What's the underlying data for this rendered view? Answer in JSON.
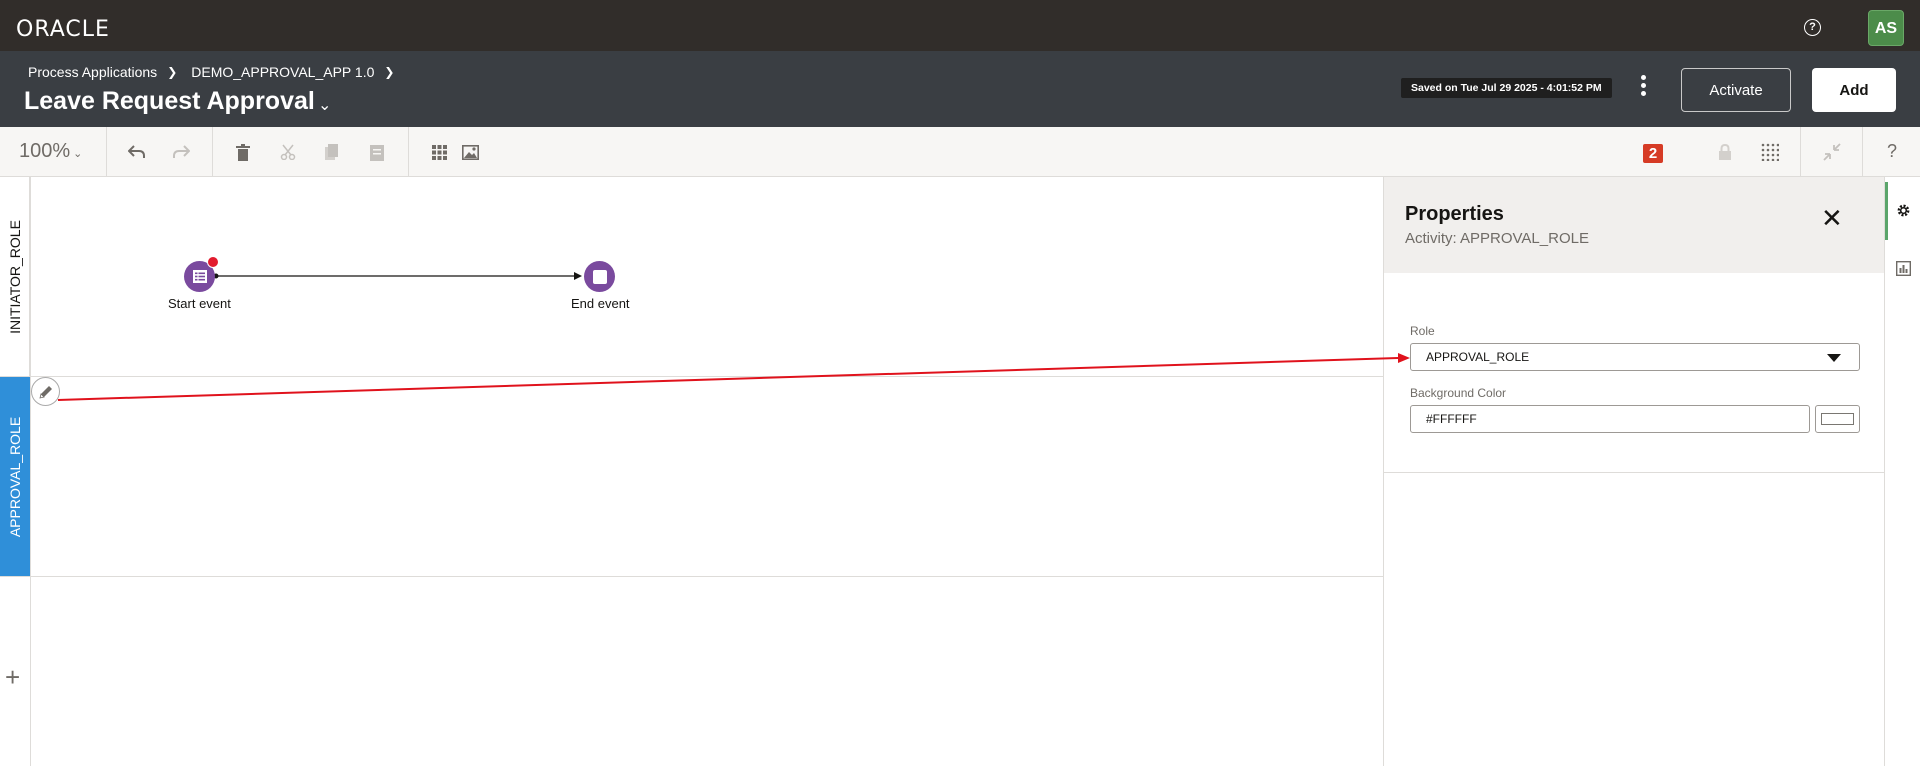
{
  "topbar": {
    "logo": "ORACLE",
    "help_icon": "help-circle-icon",
    "avatar_initials": "AS"
  },
  "header": {
    "breadcrumb": [
      "Process Applications",
      "DEMO_APPROVAL_APP 1.0"
    ],
    "title": "Leave Request Approval",
    "saved_text": "Saved on Tue Jul 29 2025 - 4:01:52 PM",
    "activate_label": "Activate",
    "add_label": "Add"
  },
  "toolbar": {
    "zoom": "100%",
    "error_count": "2",
    "help": "?",
    "icons": [
      "undo-icon",
      "redo-icon",
      "delete-icon",
      "cut-icon",
      "copy-icon",
      "paste-icon",
      "grid-icon",
      "image-icon",
      "lock-icon",
      "dots-grid-icon",
      "collapse-icon"
    ]
  },
  "canvas": {
    "lanes": [
      {
        "name": "INITIATOR_ROLE",
        "selected": false
      },
      {
        "name": "APPROVAL_ROLE",
        "selected": true
      }
    ],
    "events": [
      {
        "label": "Start event",
        "type": "start"
      },
      {
        "label": "End event",
        "type": "end"
      }
    ],
    "add_lane": "+"
  },
  "properties": {
    "title": "Properties",
    "subtitle": "Activity: APPROVAL_ROLE",
    "role_label": "Role",
    "role_value": "APPROVAL_ROLE",
    "bg_color_label": "Background Color",
    "bg_color_value": "#FFFFFF"
  },
  "colors": {
    "accent_lane": "#2f8fd9",
    "event_purple": "#7a4a9e",
    "annotation_red": "#e0121c",
    "error_badge": "#d63b25"
  }
}
